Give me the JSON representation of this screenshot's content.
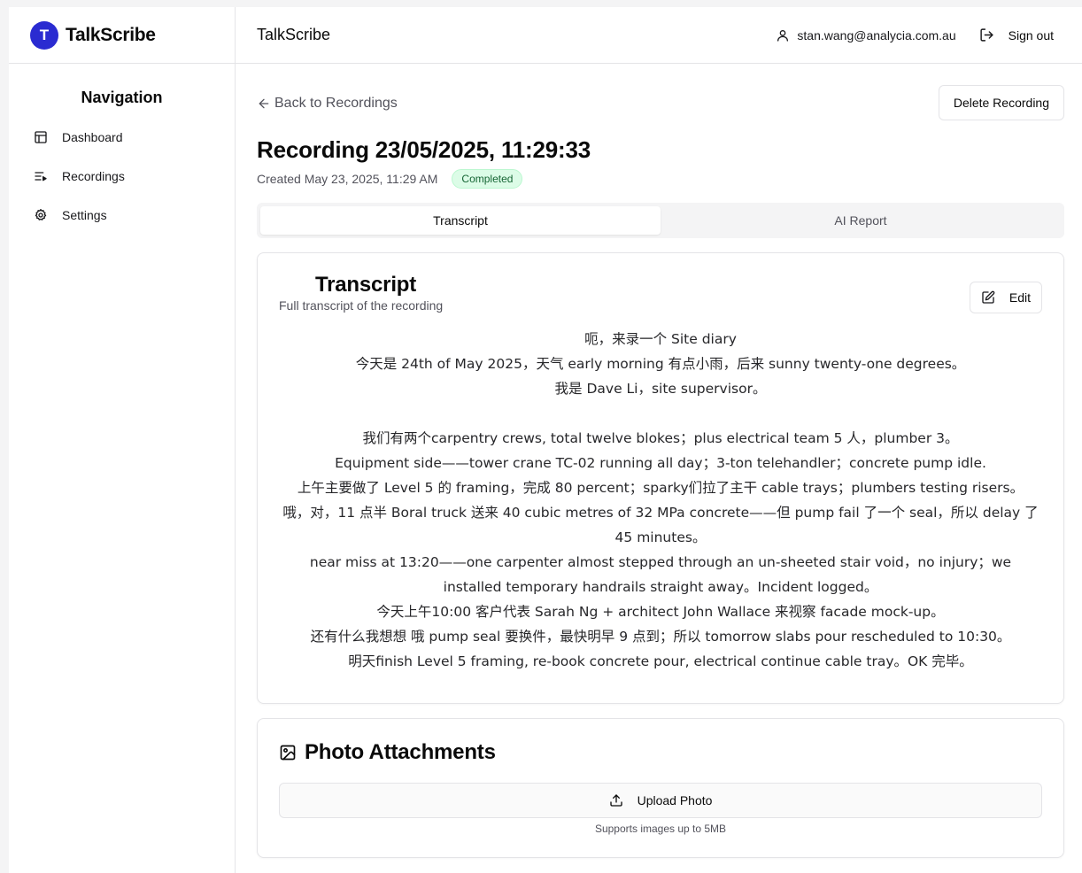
{
  "app": {
    "brand_initial": "T",
    "brand_name": "TalkScribe",
    "accent_color": "#2a2bd1"
  },
  "sidebar": {
    "heading": "Navigation",
    "items": [
      {
        "label": "Dashboard",
        "icon": "layout-dashboard-icon"
      },
      {
        "label": "Recordings",
        "icon": "list-play-icon"
      },
      {
        "label": "Settings",
        "icon": "gear-icon"
      }
    ]
  },
  "header": {
    "title": "TalkScribe",
    "user_email": "stan.wang@analycia.com.au",
    "sign_out_label": "Sign out"
  },
  "page": {
    "back_label": "Back to Recordings",
    "delete_label": "Delete Recording",
    "title": "Recording 23/05/2025, 11:29:33",
    "created": "Created May 23, 2025, 11:29 AM",
    "status": "Completed",
    "status_color": "#166534"
  },
  "tabs": [
    {
      "label": "Transcript",
      "active": true
    },
    {
      "label": "AI Report",
      "active": false
    }
  ],
  "transcript": {
    "title": "Transcript",
    "subtitle": "Full transcript of the recording",
    "edit_label": "Edit",
    "lines": [
      "呃，来录一个 Site diary",
      "今天是 24th of May 2025，天气 early morning 有点小雨，后来 sunny twenty-one degrees。",
      "我是 Dave Li，site supervisor。",
      "",
      "我们有两个carpentry crews, total twelve blokes；plus electrical team 5 人，plumber 3。",
      "Equipment side——tower crane TC-02 running all day；3-ton telehandler；concrete pump idle.",
      "上午主要做了 Level 5 的 framing，完成 80 percent；sparky们拉了主干 cable trays；plumbers testing risers。",
      "哦，对，11 点半 Boral truck 送来 40 cubic metres of 32 MPa concrete——但 pump fail 了一个 seal，所以 delay 了 45 minutes。",
      "near miss at 13:20——one carpenter almost stepped through an un-sheeted stair void，no injury；we installed temporary handrails straight away。Incident logged。",
      "今天上午10:00 客户代表 Sarah Ng + architect John Wallace 来视察 facade mock-up。",
      "还有什么我想想 哦 pump seal 要换件，最快明早 9 点到；所以 tomorrow slabs pour rescheduled to 10:30。",
      "明天finish Level 5 framing, re-book concrete pour, electrical continue cable tray。OK 完毕。"
    ]
  },
  "photos": {
    "title": "Photo Attachments",
    "upload_label": "Upload Photo",
    "hint": "Supports images up to 5MB"
  }
}
